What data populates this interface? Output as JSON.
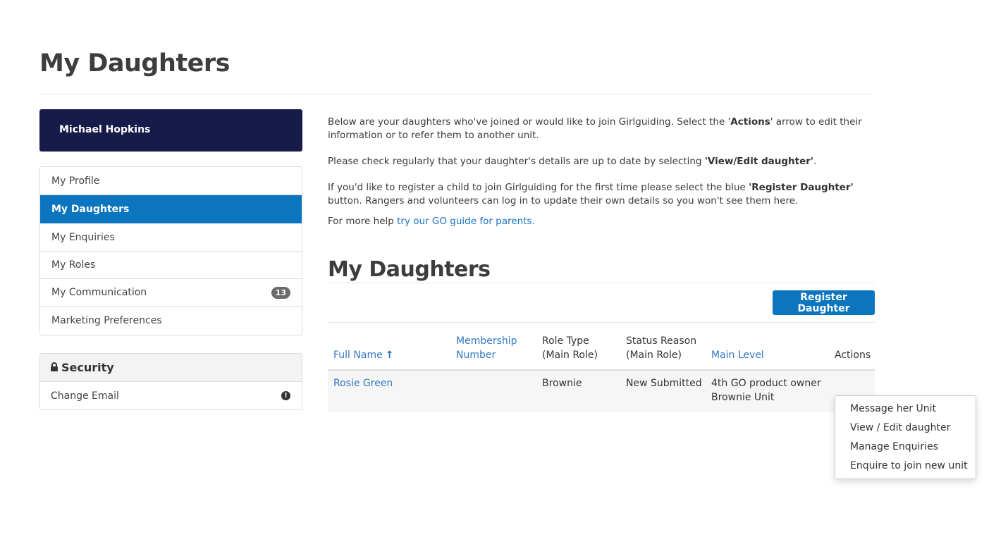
{
  "page": {
    "title": "My Daughters"
  },
  "user": {
    "name": "Michael Hopkins"
  },
  "nav": {
    "items": [
      {
        "label": "My Profile"
      },
      {
        "label": "My Daughters"
      },
      {
        "label": "My Enquiries"
      },
      {
        "label": "My Roles"
      },
      {
        "label": "My Communication",
        "badge": "13"
      },
      {
        "label": "Marketing Preferences"
      }
    ]
  },
  "security": {
    "title": "Security",
    "items": [
      {
        "label": "Change Email",
        "icon": "info-icon"
      }
    ]
  },
  "intro": {
    "p1_a": "Below are your daughters who've joined or would like to join Girlguiding. Select the '",
    "p1_b": "Actions",
    "p1_c": "' arrow to edit their information or to refer them to another unit.",
    "p2_a": "Please check regularly that your daughter's details are up to date by selecting ",
    "p2_b": "'View/Edit daughter'",
    "p2_c": ".",
    "p3_a": "If you'd like to register a child to join Girlguiding for the first time please select the blue ",
    "p3_b": "'Register Daughter'",
    "p3_c": " button. Rangers and volunteers can log in to update their own details so you won't see them here.",
    "p4_a": "For more help ",
    "p4_link": "try our GO guide for parents."
  },
  "section": {
    "title": "My Daughters",
    "register_button": "Register Daughter"
  },
  "table": {
    "headers": {
      "full_name": "Full Name",
      "membership_1": "Membership",
      "membership_2": "Number",
      "role_1": "Role Type",
      "role_2": "(Main Role)",
      "status_1": "Status Reason",
      "status_2": "(Main Role)",
      "main_level": "Main Level",
      "actions": "Actions"
    },
    "rows": [
      {
        "full_name": "Rosie Green",
        "membership_number": "",
        "role_type": "Brownie",
        "status_reason": "New Submitted",
        "main_level_1": "4th GO product owner",
        "main_level_2": "Brownie Unit"
      }
    ]
  },
  "actions_menu": {
    "items": [
      {
        "label": "Message her Unit"
      },
      {
        "label": "View / Edit daughter"
      },
      {
        "label": "Manage Enquiries"
      },
      {
        "label": "Enquire to join new unit"
      }
    ]
  },
  "colors": {
    "brand_navy": "#161b4a",
    "accent_blue": "#0b75c0",
    "link_blue": "#2f78c3"
  }
}
